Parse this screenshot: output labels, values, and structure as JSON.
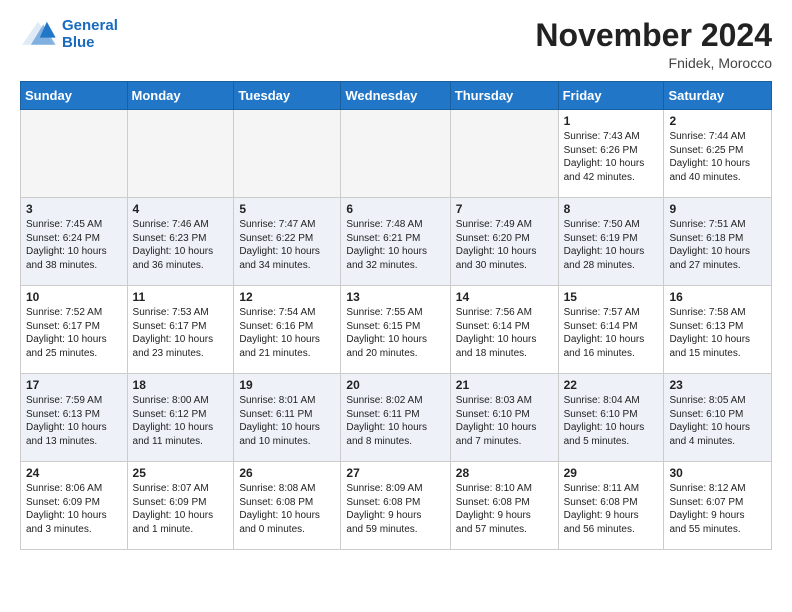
{
  "header": {
    "logo_line1": "General",
    "logo_line2": "Blue",
    "month": "November 2024",
    "location": "Fnidek, Morocco"
  },
  "weekdays": [
    "Sunday",
    "Monday",
    "Tuesday",
    "Wednesday",
    "Thursday",
    "Friday",
    "Saturday"
  ],
  "weeks": [
    [
      {
        "day": "",
        "info": ""
      },
      {
        "day": "",
        "info": ""
      },
      {
        "day": "",
        "info": ""
      },
      {
        "day": "",
        "info": ""
      },
      {
        "day": "",
        "info": ""
      },
      {
        "day": "1",
        "info": "Sunrise: 7:43 AM\nSunset: 6:26 PM\nDaylight: 10 hours\nand 42 minutes."
      },
      {
        "day": "2",
        "info": "Sunrise: 7:44 AM\nSunset: 6:25 PM\nDaylight: 10 hours\nand 40 minutes."
      }
    ],
    [
      {
        "day": "3",
        "info": "Sunrise: 7:45 AM\nSunset: 6:24 PM\nDaylight: 10 hours\nand 38 minutes."
      },
      {
        "day": "4",
        "info": "Sunrise: 7:46 AM\nSunset: 6:23 PM\nDaylight: 10 hours\nand 36 minutes."
      },
      {
        "day": "5",
        "info": "Sunrise: 7:47 AM\nSunset: 6:22 PM\nDaylight: 10 hours\nand 34 minutes."
      },
      {
        "day": "6",
        "info": "Sunrise: 7:48 AM\nSunset: 6:21 PM\nDaylight: 10 hours\nand 32 minutes."
      },
      {
        "day": "7",
        "info": "Sunrise: 7:49 AM\nSunset: 6:20 PM\nDaylight: 10 hours\nand 30 minutes."
      },
      {
        "day": "8",
        "info": "Sunrise: 7:50 AM\nSunset: 6:19 PM\nDaylight: 10 hours\nand 28 minutes."
      },
      {
        "day": "9",
        "info": "Sunrise: 7:51 AM\nSunset: 6:18 PM\nDaylight: 10 hours\nand 27 minutes."
      }
    ],
    [
      {
        "day": "10",
        "info": "Sunrise: 7:52 AM\nSunset: 6:17 PM\nDaylight: 10 hours\nand 25 minutes."
      },
      {
        "day": "11",
        "info": "Sunrise: 7:53 AM\nSunset: 6:17 PM\nDaylight: 10 hours\nand 23 minutes."
      },
      {
        "day": "12",
        "info": "Sunrise: 7:54 AM\nSunset: 6:16 PM\nDaylight: 10 hours\nand 21 minutes."
      },
      {
        "day": "13",
        "info": "Sunrise: 7:55 AM\nSunset: 6:15 PM\nDaylight: 10 hours\nand 20 minutes."
      },
      {
        "day": "14",
        "info": "Sunrise: 7:56 AM\nSunset: 6:14 PM\nDaylight: 10 hours\nand 18 minutes."
      },
      {
        "day": "15",
        "info": "Sunrise: 7:57 AM\nSunset: 6:14 PM\nDaylight: 10 hours\nand 16 minutes."
      },
      {
        "day": "16",
        "info": "Sunrise: 7:58 AM\nSunset: 6:13 PM\nDaylight: 10 hours\nand 15 minutes."
      }
    ],
    [
      {
        "day": "17",
        "info": "Sunrise: 7:59 AM\nSunset: 6:13 PM\nDaylight: 10 hours\nand 13 minutes."
      },
      {
        "day": "18",
        "info": "Sunrise: 8:00 AM\nSunset: 6:12 PM\nDaylight: 10 hours\nand 11 minutes."
      },
      {
        "day": "19",
        "info": "Sunrise: 8:01 AM\nSunset: 6:11 PM\nDaylight: 10 hours\nand 10 minutes."
      },
      {
        "day": "20",
        "info": "Sunrise: 8:02 AM\nSunset: 6:11 PM\nDaylight: 10 hours\nand 8 minutes."
      },
      {
        "day": "21",
        "info": "Sunrise: 8:03 AM\nSunset: 6:10 PM\nDaylight: 10 hours\nand 7 minutes."
      },
      {
        "day": "22",
        "info": "Sunrise: 8:04 AM\nSunset: 6:10 PM\nDaylight: 10 hours\nand 5 minutes."
      },
      {
        "day": "23",
        "info": "Sunrise: 8:05 AM\nSunset: 6:10 PM\nDaylight: 10 hours\nand 4 minutes."
      }
    ],
    [
      {
        "day": "24",
        "info": "Sunrise: 8:06 AM\nSunset: 6:09 PM\nDaylight: 10 hours\nand 3 minutes."
      },
      {
        "day": "25",
        "info": "Sunrise: 8:07 AM\nSunset: 6:09 PM\nDaylight: 10 hours\nand 1 minute."
      },
      {
        "day": "26",
        "info": "Sunrise: 8:08 AM\nSunset: 6:08 PM\nDaylight: 10 hours\nand 0 minutes."
      },
      {
        "day": "27",
        "info": "Sunrise: 8:09 AM\nSunset: 6:08 PM\nDaylight: 9 hours\nand 59 minutes."
      },
      {
        "day": "28",
        "info": "Sunrise: 8:10 AM\nSunset: 6:08 PM\nDaylight: 9 hours\nand 57 minutes."
      },
      {
        "day": "29",
        "info": "Sunrise: 8:11 AM\nSunset: 6:08 PM\nDaylight: 9 hours\nand 56 minutes."
      },
      {
        "day": "30",
        "info": "Sunrise: 8:12 AM\nSunset: 6:07 PM\nDaylight: 9 hours\nand 55 minutes."
      }
    ]
  ]
}
